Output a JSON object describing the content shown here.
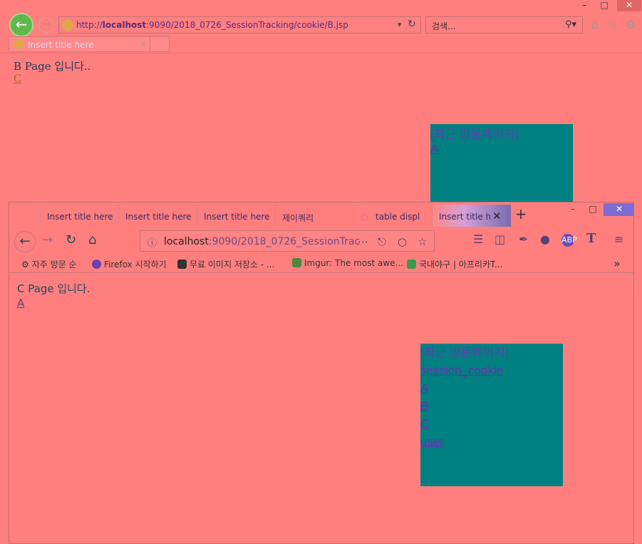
{
  "ie": {
    "window_buttons": {
      "minimize": "–",
      "maximize": "□",
      "close": "✕"
    },
    "address": {
      "scheme": "http://",
      "host": "localhost",
      "rest": ":9090/2018_0726_SessionTracking/cookie/B.jsp"
    },
    "search_placeholder": "검색...",
    "tab_title": "Insert title here",
    "page_title": "B Page 입니다..",
    "link_c": "C",
    "recent": {
      "title": "[최근 방문페이지]",
      "links": [
        "A"
      ]
    }
  },
  "ff": {
    "tabs": [
      "Insert title here",
      "Insert title here",
      "Insert title here",
      "제이쿼리",
      "table displ",
      "Insert title h"
    ],
    "window_buttons": {
      "minimize": "–",
      "maximize": "□",
      "close": "✕"
    },
    "url": {
      "host": "localhost",
      "rest": ":9090/2018_0726_SessionTrac"
    },
    "bookmarks": [
      "자주 방문 순",
      "Firefox 시작하기",
      "무료 이미지 저장소 - ...",
      "Imgur: The most awe...",
      "국내야구 | 아프리카T..."
    ],
    "page_title": "C Page 입니다.",
    "link_a": "A",
    "recent": {
      "title": "[최근 방문페이지]",
      "links": [
        "session_cookie",
        "A",
        "B",
        "C",
        "user"
      ]
    }
  },
  "colors": {
    "background": "#ff7f7f",
    "panel": "#008080",
    "link": "#6a2fb3"
  }
}
